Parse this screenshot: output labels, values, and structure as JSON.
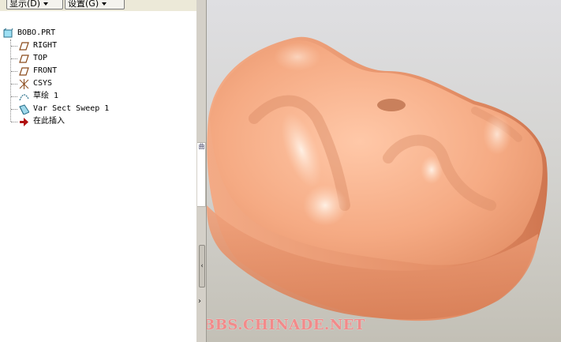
{
  "toolbar": {
    "display_label": "显示(D)",
    "settings_label": "设置(G)"
  },
  "model_tree": {
    "root": {
      "label": "BOBO.PRT",
      "icon": "part-icon"
    },
    "items": [
      {
        "label": "RIGHT",
        "icon": "datum-plane-icon"
      },
      {
        "label": "TOP",
        "icon": "datum-plane-icon"
      },
      {
        "label": "FRONT",
        "icon": "datum-plane-icon"
      },
      {
        "label": "CSYS",
        "icon": "coordinate-system-icon"
      },
      {
        "label": "草绘 1",
        "icon": "sketch-icon"
      },
      {
        "label": "Var Sect Sweep 1",
        "icon": "var-sect-sweep-icon"
      },
      {
        "label": "在此插入",
        "icon": "insert-here-arrow-icon"
      }
    ]
  },
  "viewport": {
    "model_color": "#f0a27c",
    "watermark": "BBS.CHINADE.NET",
    "watermark_color": "#f28a8a"
  }
}
